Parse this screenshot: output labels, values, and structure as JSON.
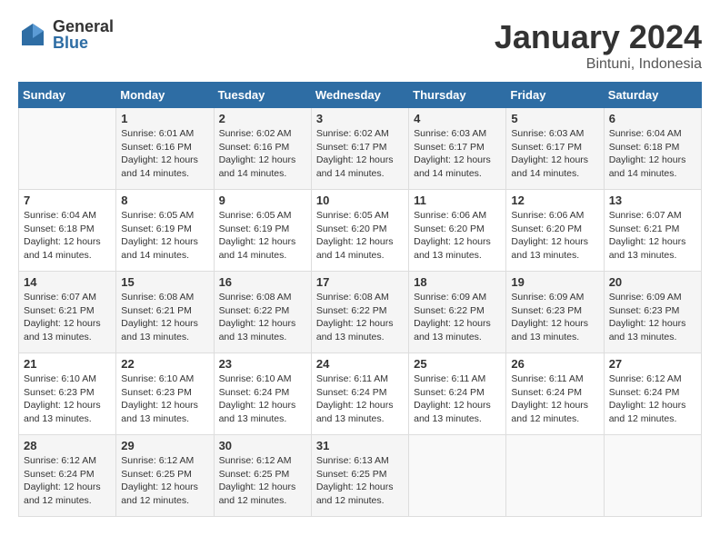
{
  "header": {
    "logo_general": "General",
    "logo_blue": "Blue",
    "title": "January 2024",
    "subtitle": "Bintuni, Indonesia"
  },
  "days_of_week": [
    "Sunday",
    "Monday",
    "Tuesday",
    "Wednesday",
    "Thursday",
    "Friday",
    "Saturday"
  ],
  "weeks": [
    [
      {
        "day": "",
        "info": ""
      },
      {
        "day": "1",
        "info": "Sunrise: 6:01 AM\nSunset: 6:16 PM\nDaylight: 12 hours\nand 14 minutes."
      },
      {
        "day": "2",
        "info": "Sunrise: 6:02 AM\nSunset: 6:16 PM\nDaylight: 12 hours\nand 14 minutes."
      },
      {
        "day": "3",
        "info": "Sunrise: 6:02 AM\nSunset: 6:17 PM\nDaylight: 12 hours\nand 14 minutes."
      },
      {
        "day": "4",
        "info": "Sunrise: 6:03 AM\nSunset: 6:17 PM\nDaylight: 12 hours\nand 14 minutes."
      },
      {
        "day": "5",
        "info": "Sunrise: 6:03 AM\nSunset: 6:17 PM\nDaylight: 12 hours\nand 14 minutes."
      },
      {
        "day": "6",
        "info": "Sunrise: 6:04 AM\nSunset: 6:18 PM\nDaylight: 12 hours\nand 14 minutes."
      }
    ],
    [
      {
        "day": "7",
        "info": "Sunrise: 6:04 AM\nSunset: 6:18 PM\nDaylight: 12 hours\nand 14 minutes."
      },
      {
        "day": "8",
        "info": "Sunrise: 6:05 AM\nSunset: 6:19 PM\nDaylight: 12 hours\nand 14 minutes."
      },
      {
        "day": "9",
        "info": "Sunrise: 6:05 AM\nSunset: 6:19 PM\nDaylight: 12 hours\nand 14 minutes."
      },
      {
        "day": "10",
        "info": "Sunrise: 6:05 AM\nSunset: 6:20 PM\nDaylight: 12 hours\nand 14 minutes."
      },
      {
        "day": "11",
        "info": "Sunrise: 6:06 AM\nSunset: 6:20 PM\nDaylight: 12 hours\nand 13 minutes."
      },
      {
        "day": "12",
        "info": "Sunrise: 6:06 AM\nSunset: 6:20 PM\nDaylight: 12 hours\nand 13 minutes."
      },
      {
        "day": "13",
        "info": "Sunrise: 6:07 AM\nSunset: 6:21 PM\nDaylight: 12 hours\nand 13 minutes."
      }
    ],
    [
      {
        "day": "14",
        "info": "Sunrise: 6:07 AM\nSunset: 6:21 PM\nDaylight: 12 hours\nand 13 minutes."
      },
      {
        "day": "15",
        "info": "Sunrise: 6:08 AM\nSunset: 6:21 PM\nDaylight: 12 hours\nand 13 minutes."
      },
      {
        "day": "16",
        "info": "Sunrise: 6:08 AM\nSunset: 6:22 PM\nDaylight: 12 hours\nand 13 minutes."
      },
      {
        "day": "17",
        "info": "Sunrise: 6:08 AM\nSunset: 6:22 PM\nDaylight: 12 hours\nand 13 minutes."
      },
      {
        "day": "18",
        "info": "Sunrise: 6:09 AM\nSunset: 6:22 PM\nDaylight: 12 hours\nand 13 minutes."
      },
      {
        "day": "19",
        "info": "Sunrise: 6:09 AM\nSunset: 6:23 PM\nDaylight: 12 hours\nand 13 minutes."
      },
      {
        "day": "20",
        "info": "Sunrise: 6:09 AM\nSunset: 6:23 PM\nDaylight: 12 hours\nand 13 minutes."
      }
    ],
    [
      {
        "day": "21",
        "info": "Sunrise: 6:10 AM\nSunset: 6:23 PM\nDaylight: 12 hours\nand 13 minutes."
      },
      {
        "day": "22",
        "info": "Sunrise: 6:10 AM\nSunset: 6:23 PM\nDaylight: 12 hours\nand 13 minutes."
      },
      {
        "day": "23",
        "info": "Sunrise: 6:10 AM\nSunset: 6:24 PM\nDaylight: 12 hours\nand 13 minutes."
      },
      {
        "day": "24",
        "info": "Sunrise: 6:11 AM\nSunset: 6:24 PM\nDaylight: 12 hours\nand 13 minutes."
      },
      {
        "day": "25",
        "info": "Sunrise: 6:11 AM\nSunset: 6:24 PM\nDaylight: 12 hours\nand 13 minutes."
      },
      {
        "day": "26",
        "info": "Sunrise: 6:11 AM\nSunset: 6:24 PM\nDaylight: 12 hours\nand 12 minutes."
      },
      {
        "day": "27",
        "info": "Sunrise: 6:12 AM\nSunset: 6:24 PM\nDaylight: 12 hours\nand 12 minutes."
      }
    ],
    [
      {
        "day": "28",
        "info": "Sunrise: 6:12 AM\nSunset: 6:24 PM\nDaylight: 12 hours\nand 12 minutes."
      },
      {
        "day": "29",
        "info": "Sunrise: 6:12 AM\nSunset: 6:25 PM\nDaylight: 12 hours\nand 12 minutes."
      },
      {
        "day": "30",
        "info": "Sunrise: 6:12 AM\nSunset: 6:25 PM\nDaylight: 12 hours\nand 12 minutes."
      },
      {
        "day": "31",
        "info": "Sunrise: 6:13 AM\nSunset: 6:25 PM\nDaylight: 12 hours\nand 12 minutes."
      },
      {
        "day": "",
        "info": ""
      },
      {
        "day": "",
        "info": ""
      },
      {
        "day": "",
        "info": ""
      }
    ]
  ]
}
